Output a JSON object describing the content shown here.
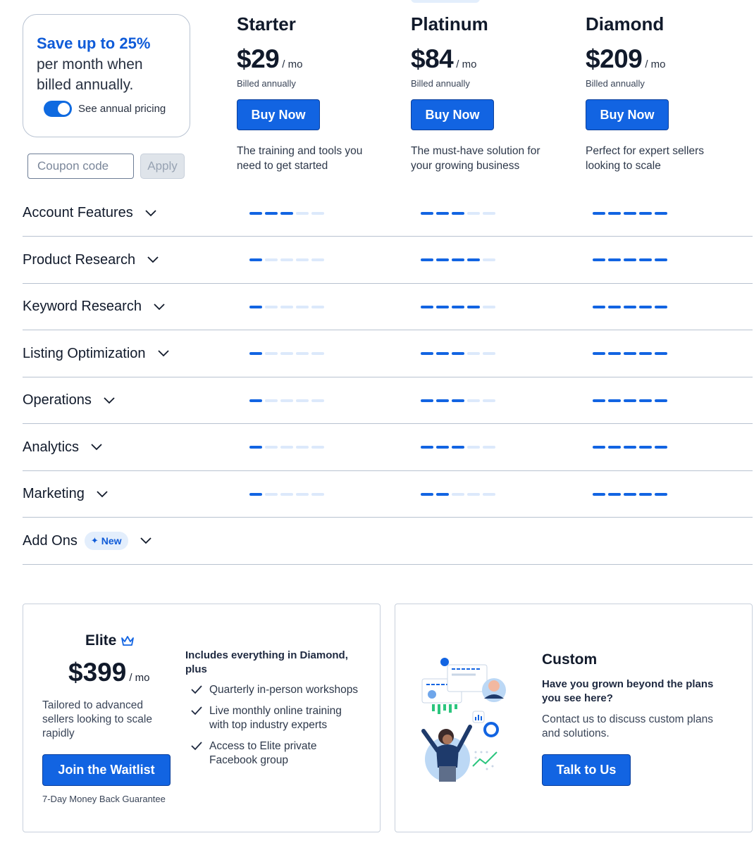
{
  "promo": {
    "headline": "Save up to 25%",
    "text": "per month when billed annually.",
    "toggle_label": "See annual pricing",
    "toggle_on": true
  },
  "coupon": {
    "placeholder": "Coupon code",
    "apply_label": "Apply"
  },
  "plans": [
    {
      "name": "Starter",
      "price": "$29",
      "per": "/ mo",
      "billed": "Billed annually",
      "button": "Buy Now",
      "description": "The training and tools you need to get started"
    },
    {
      "name": "Platinum",
      "price": "$84",
      "per": "/ mo",
      "billed": "Billed annually",
      "button": "Buy Now",
      "description": "The must-have solution for your growing business"
    },
    {
      "name": "Diamond",
      "price": "$209",
      "per": "/ mo",
      "billed": "Billed annually",
      "button": "Buy Now",
      "description": "Perfect for expert sellers looking to scale"
    }
  ],
  "features": [
    {
      "label": "Account Features",
      "levels": [
        3,
        3,
        5
      ]
    },
    {
      "label": "Product Research",
      "levels": [
        1,
        4,
        5
      ]
    },
    {
      "label": "Keyword Research",
      "levels": [
        1,
        4,
        5
      ]
    },
    {
      "label": "Listing Optimization",
      "levels": [
        1,
        3,
        5
      ]
    },
    {
      "label": "Operations",
      "levels": [
        1,
        3,
        5
      ]
    },
    {
      "label": "Analytics",
      "levels": [
        1,
        3,
        5
      ]
    },
    {
      "label": "Marketing",
      "levels": [
        1,
        2,
        5
      ]
    },
    {
      "label": "Add Ons",
      "badge": "New",
      "levels": null
    }
  ],
  "level_max": 5,
  "colors": {
    "accent": "#1264e2",
    "bar_off": "#dce9fb"
  },
  "elite": {
    "name": "Elite",
    "price": "$399",
    "per": "/ mo",
    "description": "Tailored to advanced sellers looking to scale rapidly",
    "button": "Join the Waitlist",
    "guarantee": "7-Day Money Back Guarantee",
    "includes_title": "Includes everything in Diamond, plus",
    "includes": [
      "Quarterly in-person workshops",
      "Live monthly online training with top industry experts",
      "Access to Elite private Facebook group"
    ]
  },
  "custom": {
    "title": "Custom",
    "question": "Have you grown beyond the plans you see here?",
    "description": "Contact us to discuss custom plans and solutions.",
    "button": "Talk to Us"
  }
}
